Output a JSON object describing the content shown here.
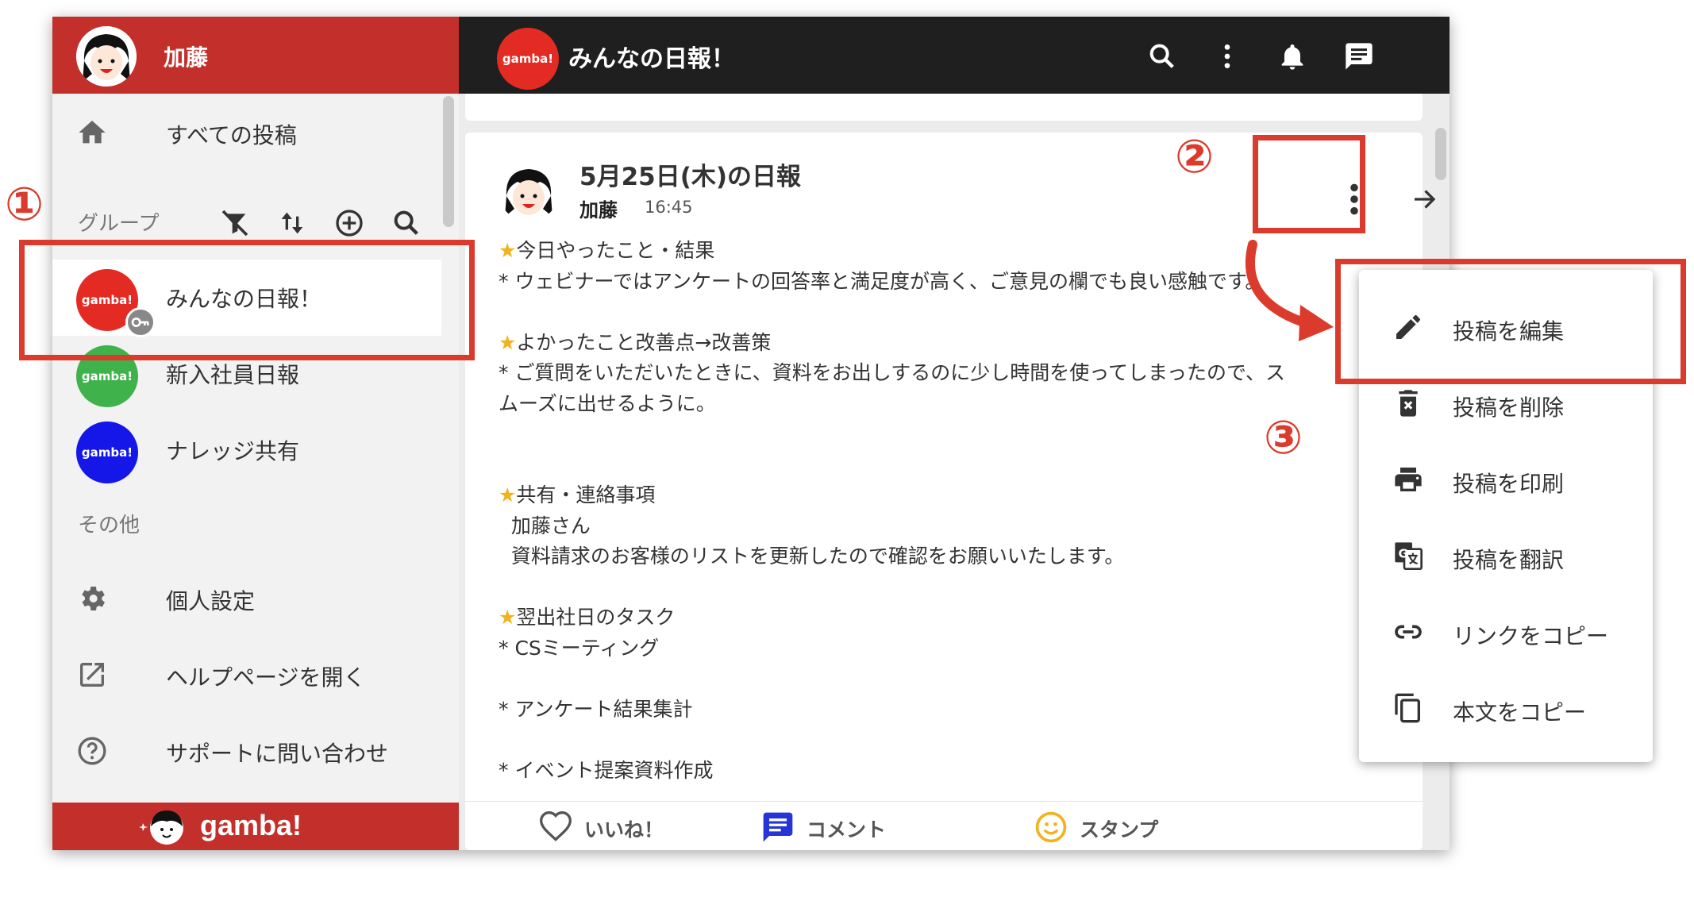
{
  "colors": {
    "brand_red": "#c3302c",
    "topbar": "#1f1f1f",
    "annotation": "#db3b2d",
    "group_red": "#e32b23",
    "group_green": "#3fb24b",
    "group_blue": "#1417e8",
    "star": "#f3b21b"
  },
  "sidebar": {
    "user_name": "加藤",
    "nav": [
      {
        "label": "すべての投稿",
        "icon": "home-icon"
      }
    ],
    "groups_section": "グループ",
    "group_tools": [
      "filter-off-icon",
      "sort-icon",
      "add-circle-icon",
      "search-icon"
    ],
    "groups": [
      {
        "label": "みんなの日報！",
        "logo": "gamba!",
        "color": "#e32b23",
        "selected": true,
        "badge": "key-icon"
      },
      {
        "label": "新入社員日報",
        "logo": "gamba!",
        "color": "#3fb24b",
        "selected": false
      },
      {
        "label": "ナレッジ共有",
        "logo": "gamba!",
        "color": "#1417e8",
        "selected": false
      }
    ],
    "other_section": "その他",
    "other": [
      {
        "label": "個人設定",
        "icon": "gear-icon"
      },
      {
        "label": "ヘルプページを開く",
        "icon": "open-external-icon"
      },
      {
        "label": "サポートに問い合わせ",
        "icon": "help-circle-icon"
      }
    ],
    "footer_logo": "gamba!"
  },
  "topbar": {
    "group_logo": "gamba!",
    "title": "みんなの日報！",
    "icons": [
      "search-icon",
      "more-vert-icon",
      "bell-icon",
      "message-icon"
    ]
  },
  "post": {
    "title": "5月25日(木)の日報",
    "author": "加藤",
    "time": "16:45",
    "star": "★",
    "body": [
      {
        "star": true,
        "text": "今日やったこと・結果"
      },
      {
        "star": false,
        "text": "* ウェビナーではアンケートの回答率と満足度が高く、ご意見の欄でも良い感触です。"
      },
      {
        "star": false,
        "text": ""
      },
      {
        "star": true,
        "text": "よかったこと改善点→改善策"
      },
      {
        "star": false,
        "text": "* ご質問をいただいたときに、資料をお出しするのに少し時間を使ってしまったので、ス"
      },
      {
        "star": false,
        "text": "ムーズに出せるように。"
      },
      {
        "star": false,
        "text": ""
      },
      {
        "star": false,
        "text": ""
      },
      {
        "star": true,
        "text": "共有・連絡事項"
      },
      {
        "star": false,
        "text": "  加藤さん"
      },
      {
        "star": false,
        "text": "  資料請求のお客様のリストを更新したので確認をお願いいたします。"
      },
      {
        "star": false,
        "text": ""
      },
      {
        "star": true,
        "text": "翌出社日のタスク"
      },
      {
        "star": false,
        "text": "* CSミーティング"
      },
      {
        "star": false,
        "text": ""
      },
      {
        "star": false,
        "text": "* アンケート結果集計"
      },
      {
        "star": false,
        "text": ""
      },
      {
        "star": false,
        "text": "* イベント提案資料作成"
      }
    ],
    "actions": [
      {
        "label": "いいね！",
        "icon": "heart-icon"
      },
      {
        "label": "コメント",
        "icon": "comment-icon"
      },
      {
        "label": "スタンプ",
        "icon": "smiley-icon"
      }
    ]
  },
  "menu": {
    "items": [
      {
        "label": "投稿を編集",
        "icon": "pencil-icon"
      },
      {
        "label": "投稿を削除",
        "icon": "delete-icon"
      },
      {
        "label": "投稿を印刷",
        "icon": "print-icon"
      },
      {
        "label": "投稿を翻訳",
        "icon": "translate-icon"
      },
      {
        "label": "リンクをコピー",
        "icon": "link-icon"
      },
      {
        "label": "本文をコピー",
        "icon": "copy-icon"
      }
    ]
  },
  "annotations": {
    "step1": "①",
    "step2": "②",
    "step3": "③"
  }
}
